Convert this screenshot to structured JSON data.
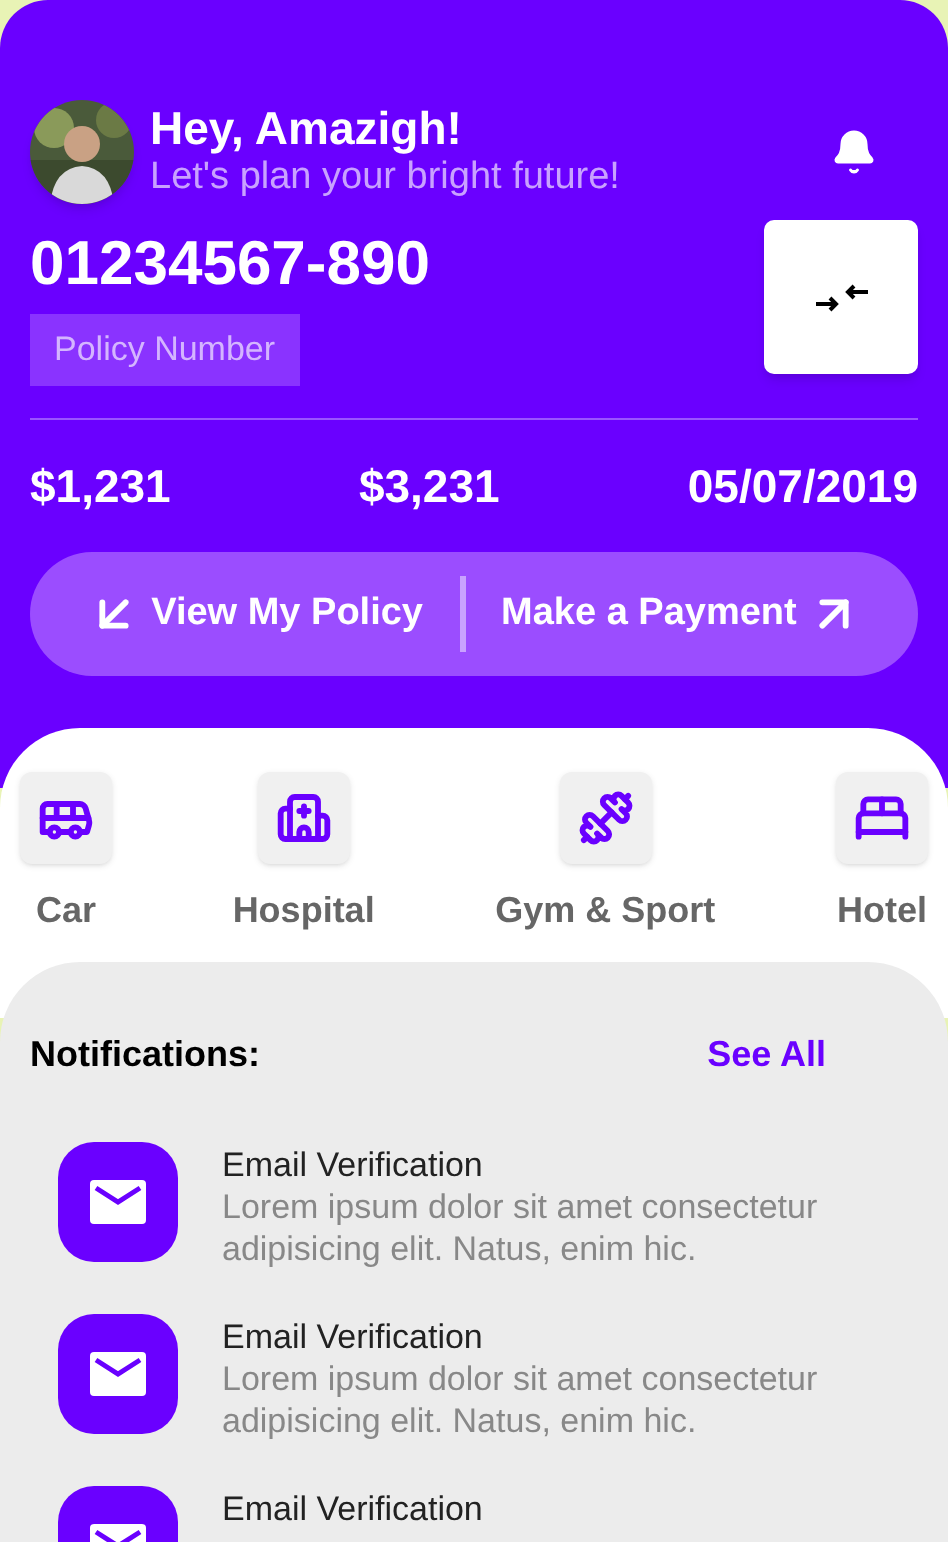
{
  "header": {
    "greeting": "Hey, Amazigh!",
    "subtitle": "Let's plan your bright future!"
  },
  "policy": {
    "number": "01234567-890",
    "label": "Policy Number"
  },
  "figures": [
    "$1,231",
    "$3,231",
    "05/07/2019"
  ],
  "actions": [
    {
      "label": "View My Policy"
    },
    {
      "label": "Make a Payment"
    }
  ],
  "categories": [
    {
      "label": "Car"
    },
    {
      "label": "Hospital"
    },
    {
      "label": "Gym & Sport"
    },
    {
      "label": "Hotel"
    }
  ],
  "notifications": {
    "title": "Notifications:",
    "see_all": "See All",
    "items": [
      {
        "title": "Email Verification",
        "body": "Lorem ipsum dolor sit amet consectetur adipisicing elit. Natus, enim hic."
      },
      {
        "title": "Email Verification",
        "body": "Lorem ipsum dolor sit amet consectetur adipisicing elit. Natus, enim hic."
      },
      {
        "title": "Email Verification"
      }
    ]
  }
}
